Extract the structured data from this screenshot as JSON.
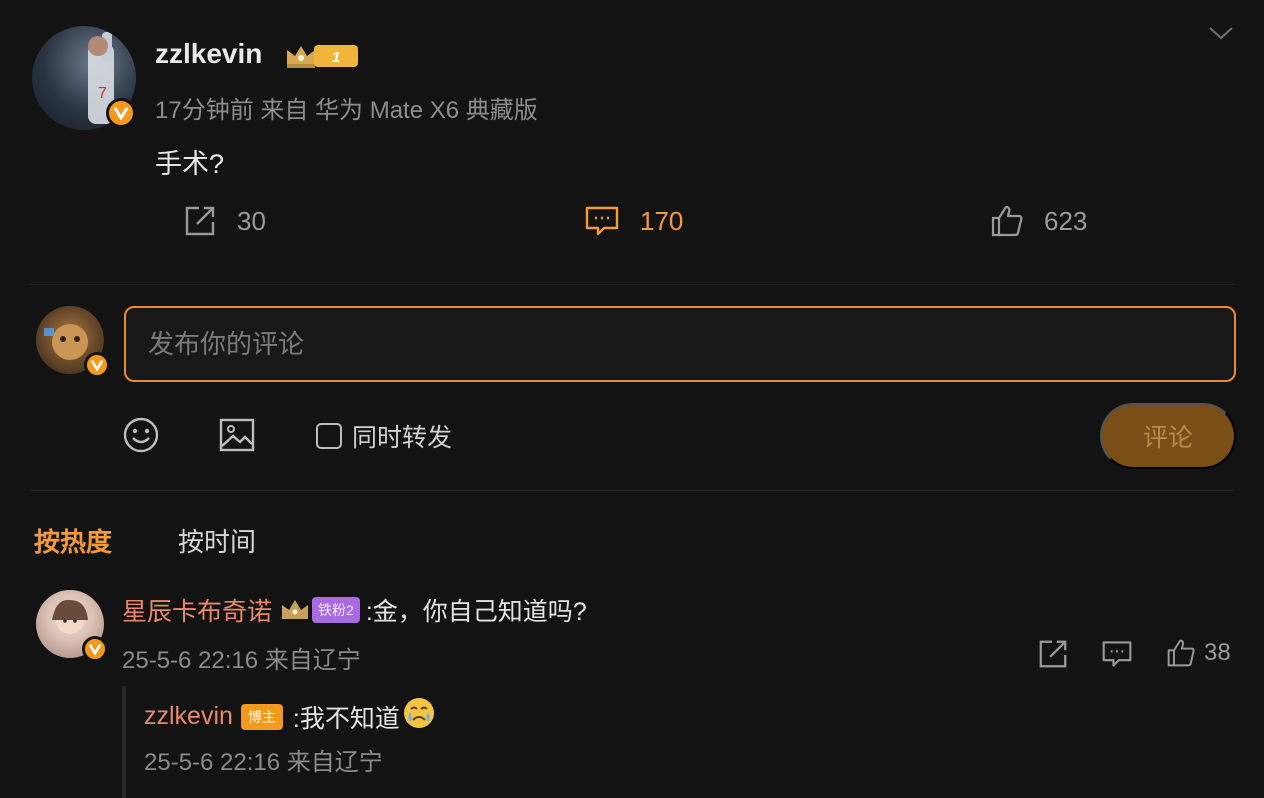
{
  "post": {
    "username": "zzlkevin",
    "level_badge": "1",
    "meta": "17分钟前  来自 华为 Mate X6 典藏版",
    "text": "手术?",
    "repost_count": "30",
    "comment_count": "170",
    "like_count": "623"
  },
  "composer": {
    "placeholder": "发布你的评论",
    "forward_label": "同时转发",
    "submit_label": "评论"
  },
  "sort": {
    "hot": "按热度",
    "time": "按时间"
  },
  "comments": [
    {
      "username": "星辰卡布奇诺",
      "fan_badge": "铁粉2",
      "text": ":金，你自己知道吗?",
      "meta": "25-5-6 22:16 来自辽宁",
      "like_count": "38",
      "replies": [
        {
          "username": "zzlkevin",
          "author_tag": "博主",
          "text": ":我不知道",
          "meta": "25-5-6 22:16 来自辽宁"
        }
      ]
    }
  ],
  "colors": {
    "accent": "#f39a3a",
    "name": "#e9876a",
    "background": "#131313"
  }
}
